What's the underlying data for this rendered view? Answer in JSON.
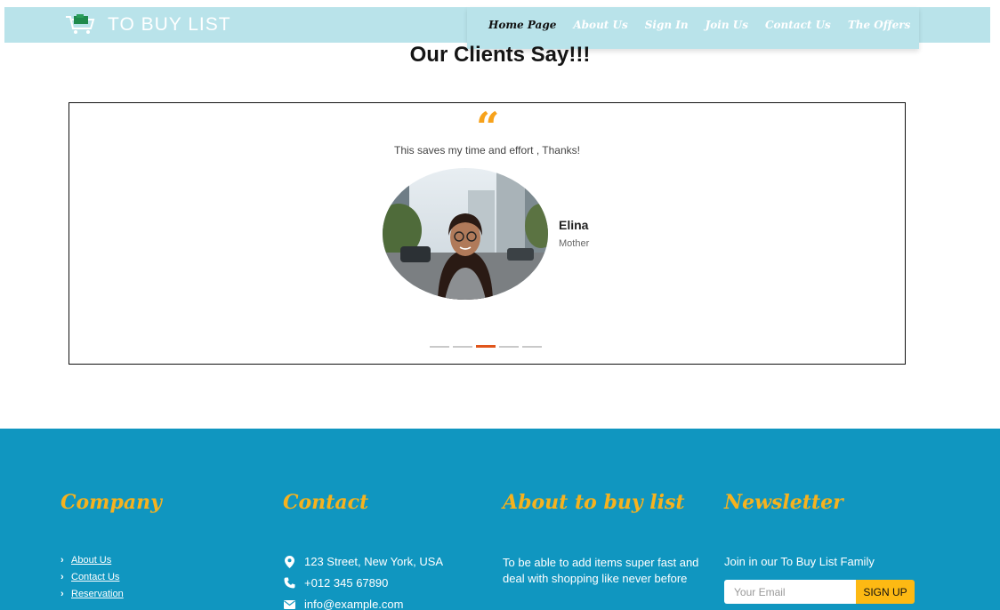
{
  "brand": {
    "name": "TO BUY LIST",
    "icon": "shopping-cart-icon"
  },
  "nav": {
    "items": [
      {
        "label": "Home Page",
        "active": true
      },
      {
        "label": "About Us",
        "active": false
      },
      {
        "label": "Sign In",
        "active": false
      },
      {
        "label": "Join Us",
        "active": false
      },
      {
        "label": "Contact Us",
        "active": false
      },
      {
        "label": "The Offers",
        "active": false
      }
    ]
  },
  "testimonials": {
    "title": "Our Clients Say!!!",
    "quote_mark": "“",
    "quote": "This saves my time and effort , Thanks!",
    "author_name": "Elina",
    "author_role": "Mother",
    "slide_count": 5,
    "active_slide": 3
  },
  "footer": {
    "company": {
      "heading": "Company",
      "links": [
        "About Us",
        "Contact Us",
        "Reservation"
      ]
    },
    "contact": {
      "heading": "Contact",
      "address": "123 Street, New York, USA",
      "phone": "+012 345 67890",
      "email": "info@example.com"
    },
    "about": {
      "heading": "About to buy list",
      "text": "To be able to add items super fast and deal with shopping like never before"
    },
    "newsletter": {
      "heading": "Newsletter",
      "text": "Join in our To Buy List Family",
      "placeholder": "Your Email",
      "button": "SIGN UP"
    }
  },
  "colors": {
    "header_bg": "#b9e3ea",
    "footer_bg": "#1096c0",
    "accent": "#f7a21b",
    "heading_gold": "#f6b21e",
    "slide_active": "#e0551b",
    "signup_bg": "#fdb913"
  }
}
